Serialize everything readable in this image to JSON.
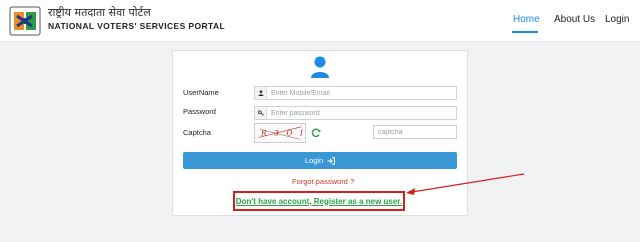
{
  "header": {
    "brand_hindi": "राष्ट्रीय मतदाता सेवा पोर्टल",
    "brand_english": "NATIONAL VOTERS' SERVICES PORTAL",
    "nav": [
      {
        "label": "Home",
        "active": true
      },
      {
        "label": "About Us",
        "active": false
      },
      {
        "label": "Login",
        "active": false
      }
    ]
  },
  "form": {
    "username_label": "UserName",
    "username_placeholder": "Enter Mobile/Email",
    "password_label": "Password",
    "password_placeholder": "Enter password",
    "captcha_label": "Captcha",
    "captcha_text": "R 3 O I D",
    "captcha_placeholder": "captcha",
    "login_button": "Login",
    "forgot_password": "Forgot password ?",
    "register_link": "Don't have account, Register as a new user."
  },
  "colors": {
    "accent": "#3a97d6",
    "active_nav": "#1e88e5",
    "forgot": "#d33a2c",
    "register": "#2fa14a",
    "annotation": "#d51f1f"
  }
}
